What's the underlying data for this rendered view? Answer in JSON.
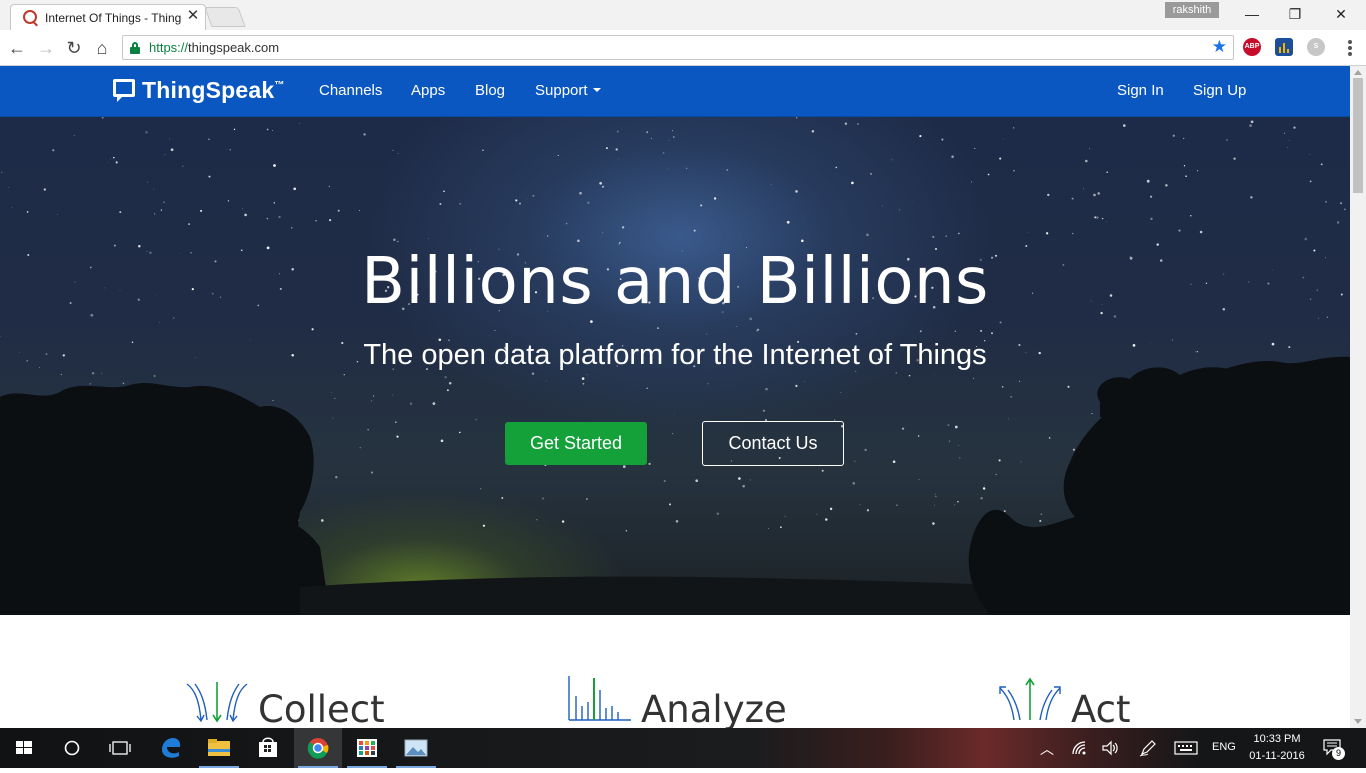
{
  "browser": {
    "tab": {
      "title": "Internet Of Things - ThingSpeak",
      "close": "✕"
    },
    "profile": "rakshith",
    "window": {
      "minimize": "—",
      "restore": "❐",
      "close": "✕"
    },
    "nav": {
      "back": "←",
      "forward": "→",
      "reload": "↻",
      "home": "⌂"
    },
    "url": {
      "scheme": "https://",
      "host": "thingspeak.com"
    },
    "bookmark_star": "★",
    "extensions": [
      {
        "name": "abp-icon",
        "label": "ABP",
        "color": "#c70d2c"
      },
      {
        "name": "analytics-icon",
        "label": "",
        "color": "#1d4e9a"
      },
      {
        "name": "skype-icon",
        "label": "S",
        "color": "#b7b7b7"
      }
    ]
  },
  "site": {
    "brand": "ThingSpeak",
    "trademark": "™",
    "nav": {
      "channels": "Channels",
      "apps": "Apps",
      "blog": "Blog",
      "support": "Support",
      "sign_in": "Sign In",
      "sign_up": "Sign Up"
    },
    "hero": {
      "title": "Billions and Billions",
      "subtitle": "The open data platform for the Internet of Things",
      "primary_button": "Get Started",
      "secondary_button": "Contact Us"
    },
    "features": [
      {
        "label": "Collect",
        "icon": "collect-arrows-icon"
      },
      {
        "label": "Analyze",
        "icon": "analyze-bars-icon"
      },
      {
        "label": "Act",
        "icon": "act-arrows-icon"
      }
    ],
    "colors": {
      "navbar": "#0a57c2",
      "primary_button": "#14a13a",
      "feature_icon_blue": "#1f5fbf",
      "feature_icon_green": "#14a13a"
    }
  },
  "taskbar": {
    "language": "ENG",
    "time": "10:33 PM",
    "date": "01-11-2016",
    "notifications": "9"
  }
}
